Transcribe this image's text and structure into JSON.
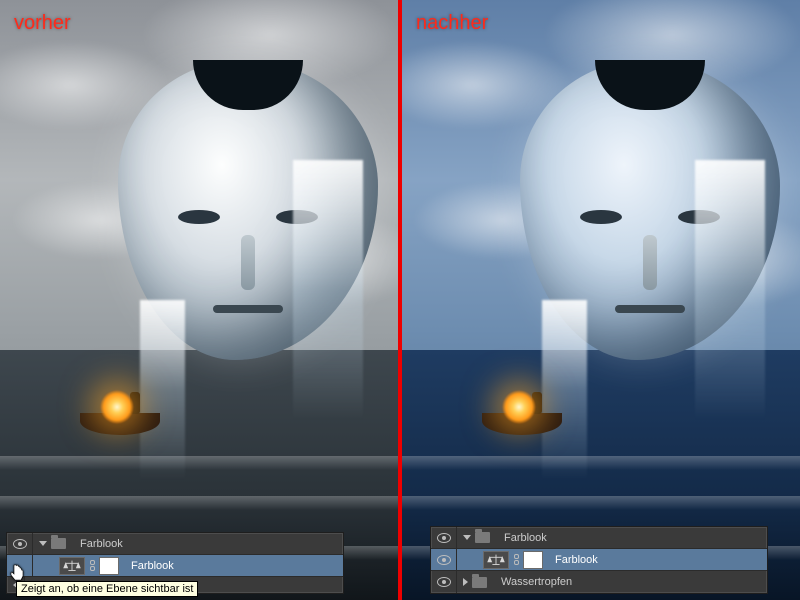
{
  "labels": {
    "before": "vorher",
    "after": "nachher"
  },
  "tooltip": "Zeigt an, ob eine Ebene sichtbar ist",
  "panel_before": {
    "group": {
      "name": "Farblook"
    },
    "adjustment": {
      "name": "Farblook"
    }
  },
  "panel_after": {
    "group1": {
      "name": "Farblook"
    },
    "adjustment": {
      "name": "Farblook"
    },
    "group2": {
      "name": "Wassertropfen"
    }
  },
  "colors": {
    "accent_red": "#ff2a1a",
    "selected_row": "#5a7a9c"
  }
}
